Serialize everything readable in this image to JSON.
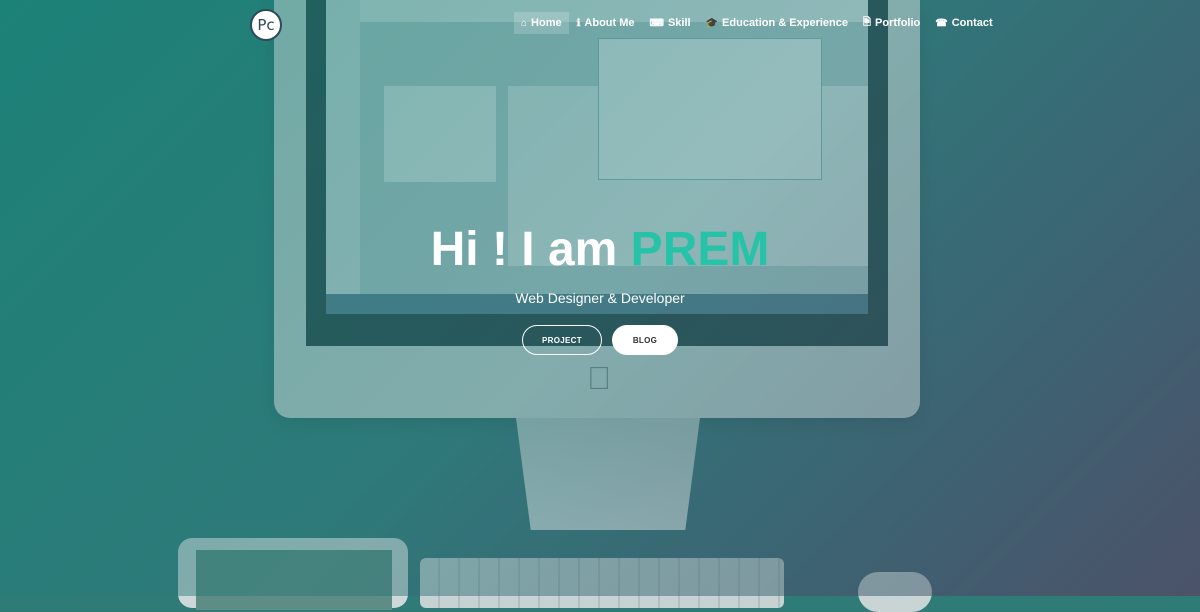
{
  "nav": {
    "logo_text": "Pc",
    "items": [
      {
        "label": "Home",
        "icon": "home-icon",
        "glyph": "⌂"
      },
      {
        "label": "About Me",
        "icon": "info-icon",
        "glyph": "ℹ"
      },
      {
        "label": "Skill",
        "icon": "keyboard-icon",
        "glyph": "⌨"
      },
      {
        "label": "Education & Experience",
        "icon": "graduation-cap-icon",
        "glyph": "🎓"
      },
      {
        "label": "Portfolio",
        "icon": "document-icon",
        "glyph": "🗎"
      },
      {
        "label": "Contact",
        "icon": "phone-icon",
        "glyph": "☎"
      }
    ]
  },
  "hero": {
    "title_prefix": "Hi ! I am",
    "title_name": "PREM",
    "subtitle": "Web Designer & Developer",
    "project_label": "PROJECT",
    "blog_label": "BLOG",
    "accent_color": "#27c3a9"
  },
  "background": {
    "apple_icon": "apple-logo-icon"
  }
}
